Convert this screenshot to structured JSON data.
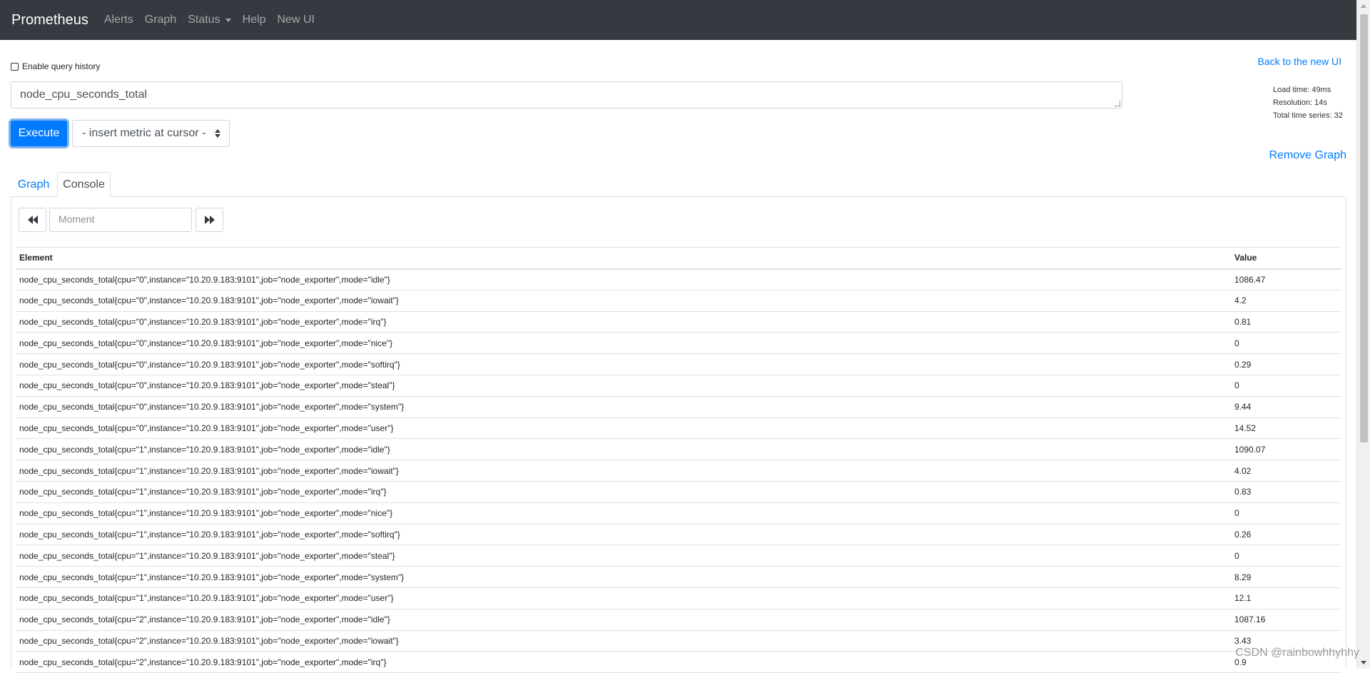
{
  "navbar": {
    "brand": "Prometheus",
    "links": [
      "Alerts",
      "Graph",
      "Status",
      "Help",
      "New UI"
    ]
  },
  "query_history": {
    "label": "Enable query history",
    "checked": false
  },
  "query": {
    "value": "node_cpu_seconds_total"
  },
  "execute_label": "Execute",
  "metric_select_label": "- insert metric at cursor -",
  "back_link": "Back to the new UI",
  "stats": {
    "load_time": "Load time: 49ms",
    "resolution": "Resolution: 14s",
    "total_series": "Total time series: 32"
  },
  "remove_graph": "Remove Graph",
  "tabs": {
    "graph": "Graph",
    "console": "Console"
  },
  "moment_placeholder": "Moment",
  "table": {
    "headers": [
      "Element",
      "Value"
    ],
    "rows": [
      {
        "element": "node_cpu_seconds_total{cpu=\"0\",instance=\"10.20.9.183:9101\",job=\"node_exporter\",mode=\"idle\"}",
        "value": "1086.47"
      },
      {
        "element": "node_cpu_seconds_total{cpu=\"0\",instance=\"10.20.9.183:9101\",job=\"node_exporter\",mode=\"iowait\"}",
        "value": "4.2"
      },
      {
        "element": "node_cpu_seconds_total{cpu=\"0\",instance=\"10.20.9.183:9101\",job=\"node_exporter\",mode=\"irq\"}",
        "value": "0.81"
      },
      {
        "element": "node_cpu_seconds_total{cpu=\"0\",instance=\"10.20.9.183:9101\",job=\"node_exporter\",mode=\"nice\"}",
        "value": "0"
      },
      {
        "element": "node_cpu_seconds_total{cpu=\"0\",instance=\"10.20.9.183:9101\",job=\"node_exporter\",mode=\"softirq\"}",
        "value": "0.29"
      },
      {
        "element": "node_cpu_seconds_total{cpu=\"0\",instance=\"10.20.9.183:9101\",job=\"node_exporter\",mode=\"steal\"}",
        "value": "0"
      },
      {
        "element": "node_cpu_seconds_total{cpu=\"0\",instance=\"10.20.9.183:9101\",job=\"node_exporter\",mode=\"system\"}",
        "value": "9.44"
      },
      {
        "element": "node_cpu_seconds_total{cpu=\"0\",instance=\"10.20.9.183:9101\",job=\"node_exporter\",mode=\"user\"}",
        "value": "14.52"
      },
      {
        "element": "node_cpu_seconds_total{cpu=\"1\",instance=\"10.20.9.183:9101\",job=\"node_exporter\",mode=\"idle\"}",
        "value": "1090.07"
      },
      {
        "element": "node_cpu_seconds_total{cpu=\"1\",instance=\"10.20.9.183:9101\",job=\"node_exporter\",mode=\"iowait\"}",
        "value": "4.02"
      },
      {
        "element": "node_cpu_seconds_total{cpu=\"1\",instance=\"10.20.9.183:9101\",job=\"node_exporter\",mode=\"irq\"}",
        "value": "0.83"
      },
      {
        "element": "node_cpu_seconds_total{cpu=\"1\",instance=\"10.20.9.183:9101\",job=\"node_exporter\",mode=\"nice\"}",
        "value": "0"
      },
      {
        "element": "node_cpu_seconds_total{cpu=\"1\",instance=\"10.20.9.183:9101\",job=\"node_exporter\",mode=\"softirq\"}",
        "value": "0.26"
      },
      {
        "element": "node_cpu_seconds_total{cpu=\"1\",instance=\"10.20.9.183:9101\",job=\"node_exporter\",mode=\"steal\"}",
        "value": "0"
      },
      {
        "element": "node_cpu_seconds_total{cpu=\"1\",instance=\"10.20.9.183:9101\",job=\"node_exporter\",mode=\"system\"}",
        "value": "8.29"
      },
      {
        "element": "node_cpu_seconds_total{cpu=\"1\",instance=\"10.20.9.183:9101\",job=\"node_exporter\",mode=\"user\"}",
        "value": "12.1"
      },
      {
        "element": "node_cpu_seconds_total{cpu=\"2\",instance=\"10.20.9.183:9101\",job=\"node_exporter\",mode=\"idle\"}",
        "value": "1087.16"
      },
      {
        "element": "node_cpu_seconds_total{cpu=\"2\",instance=\"10.20.9.183:9101\",job=\"node_exporter\",mode=\"iowait\"}",
        "value": "3.43"
      },
      {
        "element": "node_cpu_seconds_total{cpu=\"2\",instance=\"10.20.9.183:9101\",job=\"node_exporter\",mode=\"irq\"}",
        "value": "0.9"
      }
    ]
  },
  "watermark": "CSDN @rainbowhhyhhy",
  "colors": {
    "navbar_bg": "#343a40",
    "primary": "#007bff",
    "border": "#dee2e6"
  },
  "icons": {
    "back": "backward-icon",
    "forward": "forward-icon",
    "select_arrows": "select-arrows-icon",
    "status_caret": "caret-down-icon"
  }
}
